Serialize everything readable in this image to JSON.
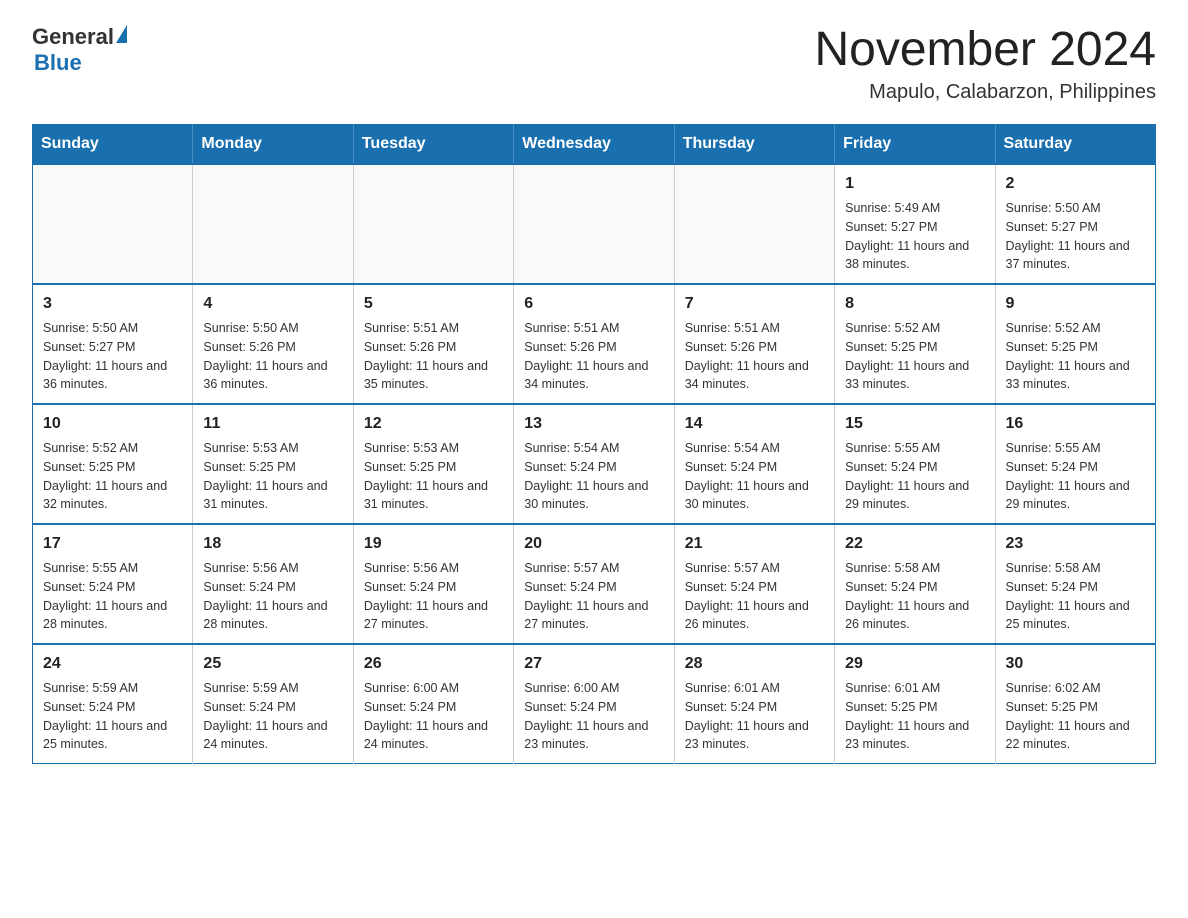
{
  "header": {
    "logo_general": "General",
    "logo_blue": "Blue",
    "main_title": "November 2024",
    "subtitle": "Mapulo, Calabarzon, Philippines"
  },
  "days_of_week": [
    "Sunday",
    "Monday",
    "Tuesday",
    "Wednesday",
    "Thursday",
    "Friday",
    "Saturday"
  ],
  "weeks": [
    [
      {
        "day": "",
        "info": ""
      },
      {
        "day": "",
        "info": ""
      },
      {
        "day": "",
        "info": ""
      },
      {
        "day": "",
        "info": ""
      },
      {
        "day": "",
        "info": ""
      },
      {
        "day": "1",
        "info": "Sunrise: 5:49 AM\nSunset: 5:27 PM\nDaylight: 11 hours and 38 minutes."
      },
      {
        "day": "2",
        "info": "Sunrise: 5:50 AM\nSunset: 5:27 PM\nDaylight: 11 hours and 37 minutes."
      }
    ],
    [
      {
        "day": "3",
        "info": "Sunrise: 5:50 AM\nSunset: 5:27 PM\nDaylight: 11 hours and 36 minutes."
      },
      {
        "day": "4",
        "info": "Sunrise: 5:50 AM\nSunset: 5:26 PM\nDaylight: 11 hours and 36 minutes."
      },
      {
        "day": "5",
        "info": "Sunrise: 5:51 AM\nSunset: 5:26 PM\nDaylight: 11 hours and 35 minutes."
      },
      {
        "day": "6",
        "info": "Sunrise: 5:51 AM\nSunset: 5:26 PM\nDaylight: 11 hours and 34 minutes."
      },
      {
        "day": "7",
        "info": "Sunrise: 5:51 AM\nSunset: 5:26 PM\nDaylight: 11 hours and 34 minutes."
      },
      {
        "day": "8",
        "info": "Sunrise: 5:52 AM\nSunset: 5:25 PM\nDaylight: 11 hours and 33 minutes."
      },
      {
        "day": "9",
        "info": "Sunrise: 5:52 AM\nSunset: 5:25 PM\nDaylight: 11 hours and 33 minutes."
      }
    ],
    [
      {
        "day": "10",
        "info": "Sunrise: 5:52 AM\nSunset: 5:25 PM\nDaylight: 11 hours and 32 minutes."
      },
      {
        "day": "11",
        "info": "Sunrise: 5:53 AM\nSunset: 5:25 PM\nDaylight: 11 hours and 31 minutes."
      },
      {
        "day": "12",
        "info": "Sunrise: 5:53 AM\nSunset: 5:25 PM\nDaylight: 11 hours and 31 minutes."
      },
      {
        "day": "13",
        "info": "Sunrise: 5:54 AM\nSunset: 5:24 PM\nDaylight: 11 hours and 30 minutes."
      },
      {
        "day": "14",
        "info": "Sunrise: 5:54 AM\nSunset: 5:24 PM\nDaylight: 11 hours and 30 minutes."
      },
      {
        "day": "15",
        "info": "Sunrise: 5:55 AM\nSunset: 5:24 PM\nDaylight: 11 hours and 29 minutes."
      },
      {
        "day": "16",
        "info": "Sunrise: 5:55 AM\nSunset: 5:24 PM\nDaylight: 11 hours and 29 minutes."
      }
    ],
    [
      {
        "day": "17",
        "info": "Sunrise: 5:55 AM\nSunset: 5:24 PM\nDaylight: 11 hours and 28 minutes."
      },
      {
        "day": "18",
        "info": "Sunrise: 5:56 AM\nSunset: 5:24 PM\nDaylight: 11 hours and 28 minutes."
      },
      {
        "day": "19",
        "info": "Sunrise: 5:56 AM\nSunset: 5:24 PM\nDaylight: 11 hours and 27 minutes."
      },
      {
        "day": "20",
        "info": "Sunrise: 5:57 AM\nSunset: 5:24 PM\nDaylight: 11 hours and 27 minutes."
      },
      {
        "day": "21",
        "info": "Sunrise: 5:57 AM\nSunset: 5:24 PM\nDaylight: 11 hours and 26 minutes."
      },
      {
        "day": "22",
        "info": "Sunrise: 5:58 AM\nSunset: 5:24 PM\nDaylight: 11 hours and 26 minutes."
      },
      {
        "day": "23",
        "info": "Sunrise: 5:58 AM\nSunset: 5:24 PM\nDaylight: 11 hours and 25 minutes."
      }
    ],
    [
      {
        "day": "24",
        "info": "Sunrise: 5:59 AM\nSunset: 5:24 PM\nDaylight: 11 hours and 25 minutes."
      },
      {
        "day": "25",
        "info": "Sunrise: 5:59 AM\nSunset: 5:24 PM\nDaylight: 11 hours and 24 minutes."
      },
      {
        "day": "26",
        "info": "Sunrise: 6:00 AM\nSunset: 5:24 PM\nDaylight: 11 hours and 24 minutes."
      },
      {
        "day": "27",
        "info": "Sunrise: 6:00 AM\nSunset: 5:24 PM\nDaylight: 11 hours and 23 minutes."
      },
      {
        "day": "28",
        "info": "Sunrise: 6:01 AM\nSunset: 5:24 PM\nDaylight: 11 hours and 23 minutes."
      },
      {
        "day": "29",
        "info": "Sunrise: 6:01 AM\nSunset: 5:25 PM\nDaylight: 11 hours and 23 minutes."
      },
      {
        "day": "30",
        "info": "Sunrise: 6:02 AM\nSunset: 5:25 PM\nDaylight: 11 hours and 22 minutes."
      }
    ]
  ]
}
